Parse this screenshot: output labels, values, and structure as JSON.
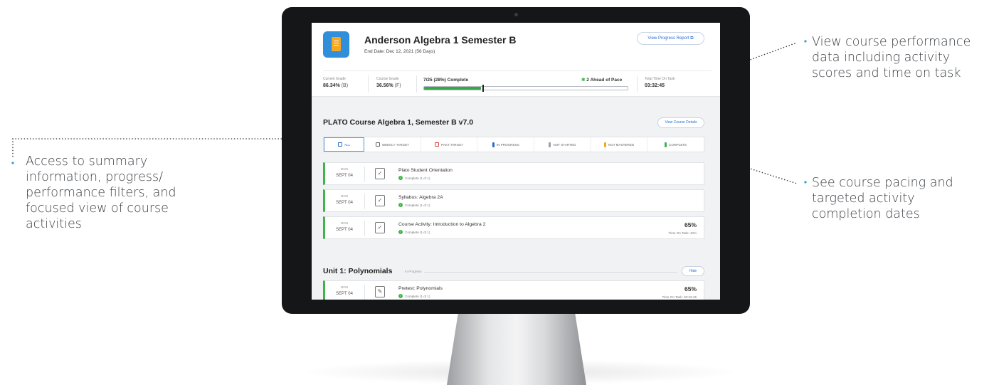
{
  "callouts": {
    "top_right": "View course performance data including activity scores and time on task",
    "mid_right": "See course pacing and targeted activity completion dates",
    "left": "Access to summary information, progress/ performance filters, and focused view of course activities"
  },
  "header": {
    "course_title": "Anderson Algebra 1 Semester B",
    "end_date": "End Date: Dec 12, 2021 (56 Days)",
    "progress_report_button": "View Progress Report ⧉",
    "current_grade_label": "Current Grade",
    "current_grade_value": "86.34%",
    "current_grade_letter": "(B)",
    "course_grade_label": "Course Grade",
    "course_grade_value": "36.56%",
    "course_grade_letter": "(F)",
    "complete_text": "7/25 (28%) Complete",
    "completion_fraction": 0.28,
    "pace_text": "2 Ahead of Pace",
    "total_time_label": "Total Time On Task",
    "total_time_value": "03:32:45"
  },
  "course": {
    "title": "PLATO Course Algebra 1, Semester B v7.0",
    "details_button": "View Course Details",
    "filters": [
      {
        "label": "ALL",
        "icon": "grid-icon"
      },
      {
        "label": "WEEKLY TARGET",
        "icon": "calendar-icon"
      },
      {
        "label": "PAST TARGET",
        "icon": "calendar-alert-icon"
      },
      {
        "label": "IN PROGRESS",
        "color": "#2a6bd1"
      },
      {
        "label": "NOT STARTED",
        "color": "#9aa0a6"
      },
      {
        "label": "NOT MASTERED",
        "color": "#f5a623"
      },
      {
        "label": "COMPLETE",
        "color": "#3fb549"
      }
    ]
  },
  "activities": [
    {
      "day": "MON",
      "date": "SEPT 04",
      "name": "Plato Student Orientation",
      "status": "Complete (1 of 1)",
      "score": "",
      "time": ""
    },
    {
      "day": "MON",
      "date": "SEPT 04",
      "name": "Syllabus: Algebra 2A",
      "status": "Complete (1 of 1)",
      "score": "",
      "time": ""
    },
    {
      "day": "MON",
      "date": "SEPT 04",
      "name": "Course Activity: Introduction to Algebra 2",
      "status": "Complete (1 of 1)",
      "score": "65%",
      "time": "Time On Task: 42m"
    }
  ],
  "unit": {
    "title": "Unit 1: Polynomials",
    "status": "In Progress",
    "hide_button": "Hide",
    "activity": {
      "day": "MON",
      "date": "SEPT 04",
      "name": "Pretest: Polynomials",
      "status": "Complete (1 of 1)",
      "score": "65%",
      "time": "Time On Task: 03:32:45"
    }
  }
}
